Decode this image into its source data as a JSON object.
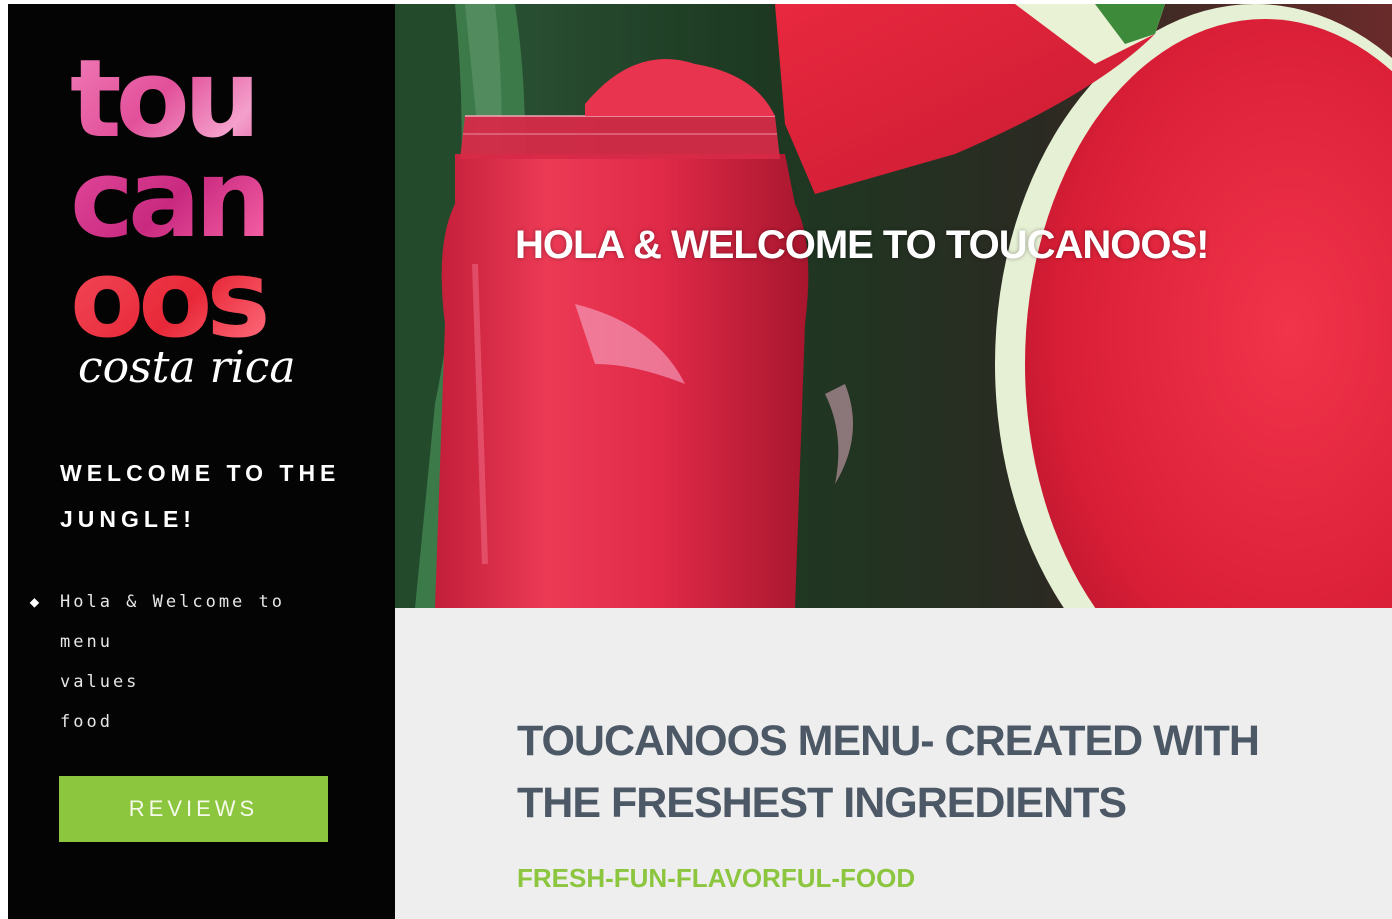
{
  "brand": {
    "logo_line1": "tou",
    "logo_line2": "can",
    "logo_line3": "oos",
    "logo_line4": "costa rica"
  },
  "sidebar": {
    "welcome_text": "WELCOME TO THE JUNGLE!",
    "nav_items": [
      {
        "label": "Hola & Welcome to",
        "active": true,
        "marker_icon": "diamond-icon"
      },
      {
        "label": "menu",
        "active": false
      },
      {
        "label": "values",
        "active": false
      },
      {
        "label": "food",
        "active": false
      }
    ],
    "marker_glyph": "◆",
    "reviews_label": "REVIEWS"
  },
  "hero": {
    "title": "HOLA & WELCOME TO TOUCANOOS!"
  },
  "content": {
    "title": "TOUCANOOS MENU- CREATED WITH THE FRESHEST INGREDIENTS",
    "subtitle": "FRESH-FUN-FLAVORFUL-FOOD"
  },
  "colors": {
    "sidebar_bg": "#040404",
    "accent_green": "#8cc63f",
    "content_bg": "#eeeeee",
    "heading_gray": "#4c5866",
    "logo_pink": "#e2509a",
    "logo_red": "#e82838"
  }
}
